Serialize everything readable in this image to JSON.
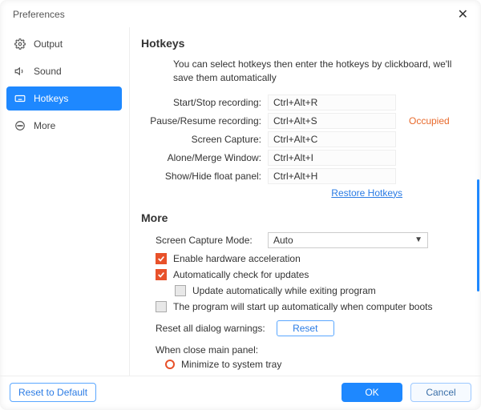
{
  "window": {
    "title": "Preferences"
  },
  "sidebar": {
    "items": [
      {
        "label": "Output",
        "icon": "settings"
      },
      {
        "label": "Sound",
        "icon": "speaker"
      },
      {
        "label": "Hotkeys",
        "icon": "keyboard"
      },
      {
        "label": "More",
        "icon": "more"
      }
    ],
    "active_index": 2
  },
  "hotkeys": {
    "heading": "Hotkeys",
    "intro": "You can select hotkeys then enter the hotkeys by clickboard, we'll save them automatically",
    "rows": [
      {
        "label": "Start/Stop recording:",
        "value": "Ctrl+Alt+R",
        "status": ""
      },
      {
        "label": "Pause/Resume recording:",
        "value": "Ctrl+Alt+S",
        "status": "Occupied"
      },
      {
        "label": "Screen Capture:",
        "value": "Ctrl+Alt+C",
        "status": ""
      },
      {
        "label": "Alone/Merge Window:",
        "value": "Ctrl+Alt+I",
        "status": ""
      },
      {
        "label": "Show/Hide float panel:",
        "value": "Ctrl+Alt+H",
        "status": ""
      }
    ],
    "restore": "Restore Hotkeys"
  },
  "more": {
    "heading": "More",
    "capture_mode_label": "Screen Capture Mode:",
    "capture_mode_value": "Auto",
    "checks": {
      "hw_accel": {
        "label": "Enable hardware acceleration",
        "checked": true
      },
      "auto_update": {
        "label": "Automatically check for updates",
        "checked": true
      },
      "update_on_exit": {
        "label": "Update automatically while exiting program",
        "checked": false
      },
      "startup": {
        "label": "The program will start up automatically when computer boots",
        "checked": false
      }
    },
    "reset_warnings_label": "Reset all dialog warnings:",
    "reset_btn": "Reset",
    "close_panel_label": "When close main panel:",
    "close_panel_options": [
      {
        "label": "Minimize to system tray",
        "selected": false
      }
    ]
  },
  "footer": {
    "reset_default": "Reset to Default",
    "ok": "OK",
    "cancel": "Cancel"
  }
}
